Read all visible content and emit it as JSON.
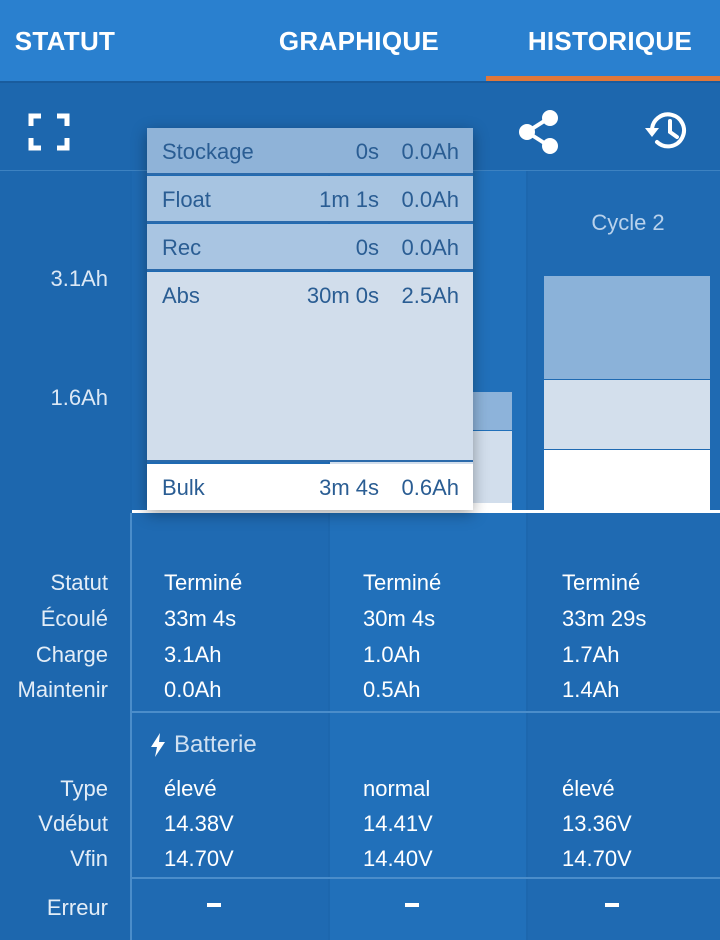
{
  "tabs": [
    {
      "label": "STATUT"
    },
    {
      "label": "GRAPHIQUE"
    },
    {
      "label": "HISTORIQUE"
    }
  ],
  "active_tab": "HISTORIQUE",
  "toolbar": {
    "icons": [
      "fullscreen-icon",
      "share-icon",
      "history-icon"
    ]
  },
  "chart": {
    "y_labels": [
      "3.1Ah",
      "1.6Ah"
    ],
    "cycle_labels": [
      "Cycle 2"
    ]
  },
  "tooltip": {
    "rows": [
      {
        "name": "Stockage",
        "time": "0s",
        "ah": "0.0Ah"
      },
      {
        "name": "Float",
        "time": "1m 1s",
        "ah": "0.0Ah"
      },
      {
        "name": "Rec",
        "time": "0s",
        "ah": "0.0Ah"
      },
      {
        "name": "Abs",
        "time": "30m 0s",
        "ah": "2.5Ah"
      },
      {
        "name": "Bulk",
        "time": "3m 4s",
        "ah": "0.6Ah"
      }
    ]
  },
  "table": {
    "row_labels": {
      "statut": "Statut",
      "ecoule": "Écoulé",
      "charge": "Charge",
      "maintenir": "Maintenir",
      "type": "Type",
      "vdebut": "Vdébut",
      "vfin": "Vfin",
      "erreur": "Erreur"
    },
    "section_battery": "Batterie",
    "columns": [
      {
        "statut": "Terminé",
        "ecoule": "33m 4s",
        "charge": "3.1Ah",
        "maintenir": "0.0Ah",
        "type": "élevé",
        "vdebut": "14.38V",
        "vfin": "14.70V",
        "erreur": ""
      },
      {
        "statut": "Terminé",
        "ecoule": "30m 4s",
        "charge": "1.0Ah",
        "maintenir": "0.5Ah",
        "type": "normal",
        "vdebut": "14.41V",
        "vfin": "14.40V",
        "erreur": ""
      },
      {
        "statut": "Terminé",
        "ecoule": "33m 29s",
        "charge": "1.7Ah",
        "maintenir": "1.4Ah",
        "type": "élevé",
        "vdebut": "13.36V",
        "vfin": "14.70V",
        "erreur": ""
      }
    ]
  },
  "colors": {
    "tab_bar": "#2a80cf",
    "background": "#1d67ae",
    "accent_underline": "#e0773a"
  }
}
